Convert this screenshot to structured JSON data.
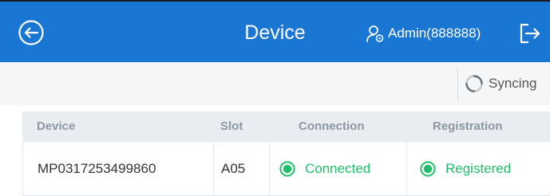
{
  "header": {
    "title": "Device",
    "user_label": "Admin(888888)",
    "back_icon": "back-arrow-circle-icon",
    "user_icon": "user-settings-icon",
    "logout_icon": "logout-icon"
  },
  "toolbar": {
    "sync_label": "Syncing",
    "sync_icon": "sync-spinner-icon"
  },
  "table": {
    "columns": [
      "Device",
      "Slot",
      "Connection",
      "Registration"
    ],
    "rows": [
      {
        "device": "MP0317253499860",
        "slot": "A05",
        "connection": "Connected",
        "registration": "Registered"
      }
    ]
  },
  "colors": {
    "header_bg": "#1976d2",
    "status_green": "#1fbf6a",
    "toolbar_bg": "#f4f6f8",
    "table_header_bg": "#e9edf1"
  }
}
